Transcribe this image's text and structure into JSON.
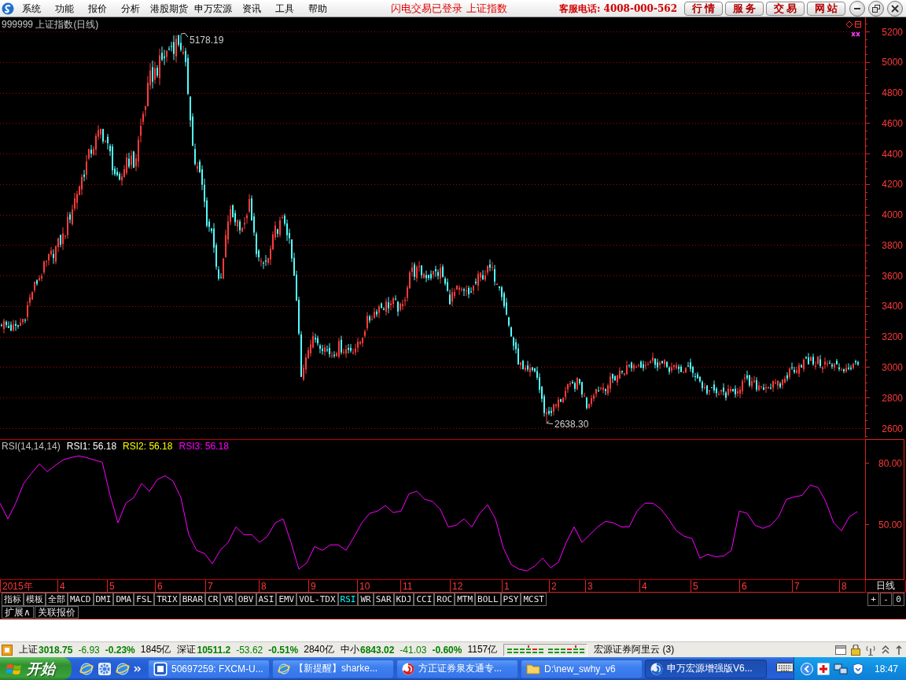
{
  "menu_bar": {
    "menus": [
      "系统",
      "功能",
      "报价",
      "分析",
      "港股期货",
      "申万宏源",
      "资讯",
      "工具",
      "帮助"
    ],
    "notices": [
      "闪电交易已登录",
      "上证指数"
    ],
    "hotline": "客服电话: 4008-000-562",
    "shortcuts": [
      "行 情",
      "服 务",
      "交 易",
      "网 站"
    ]
  },
  "price_chart": {
    "title": "999999 上证指数(日线)",
    "axis_labels": [
      "5200",
      "5000",
      "4800",
      "4600",
      "4400",
      "4200",
      "4000",
      "3800",
      "3600",
      "3400",
      "3200",
      "3000",
      "2800",
      "2600"
    ],
    "high_label": "5178.19",
    "low_label": "2638.30"
  },
  "indicator_panel": {
    "title": "RSI(14,14,14)",
    "legend": [
      {
        "text": "RSI1: 56.18",
        "color": "#ffffff"
      },
      {
        "text": "RSI2: 56.18",
        "color": "#ffff00"
      },
      {
        "text": "RSI3: 56.18",
        "color": "#ff00ff"
      }
    ],
    "chart_data": {
      "type": "line",
      "ylim": [
        23,
        91.5
      ],
      "yticks": [
        {
          "value": 80,
          "label": "80.00"
        },
        {
          "value": 50,
          "label": "50.00"
        }
      ],
      "series": [
        {
          "color": "#ff00ff",
          "values": [
            60.4,
            52.7,
            60.4,
            70.0,
            75.0,
            79.6,
            75.8,
            78.8,
            81.5,
            82.7,
            83.5,
            82.7,
            81.5,
            80.4,
            64.2,
            50.8,
            60.4,
            63.1,
            70.0,
            66.2,
            71.9,
            73.8,
            71.2,
            63.1,
            45.0,
            37.3,
            35.8,
            30.8,
            37.3,
            41.2,
            48.8,
            45.0,
            45.0,
            41.2,
            44.2,
            50.8,
            52.7,
            41.2,
            28.1,
            31.2,
            39.2,
            37.3,
            40.0,
            40.0,
            37.3,
            43.8,
            50.8,
            55.4,
            56.5,
            59.2,
            55.8,
            56.5,
            65.0,
            66.2,
            62.3,
            61.2,
            57.3,
            48.8,
            49.6,
            52.7,
            48.8,
            55.4,
            59.6,
            52.7,
            38.5,
            30.4,
            28.1,
            27.3,
            29.6,
            33.5,
            28.8,
            31.5,
            41.2,
            48.8,
            41.2,
            45.0,
            48.8,
            51.5,
            50.8,
            48.8,
            48.8,
            56.5,
            60.4,
            60.4,
            57.7,
            52.7,
            46.9,
            44.2,
            43.1,
            33.5,
            35.4,
            34.2,
            34.6,
            37.3,
            56.5,
            55.4,
            49.6,
            48.1,
            49.6,
            53.8,
            62.3,
            63.5,
            64.2,
            69.2,
            68.1,
            61.2,
            50.8,
            46.9,
            53.8,
            56.2
          ]
        }
      ]
    }
  },
  "time_axis": {
    "labels": [
      "2015年",
      "4",
      "5",
      "6",
      "7",
      "8",
      "9",
      "10",
      "11",
      "12",
      "1",
      "2",
      "3",
      "4",
      "5",
      "6",
      "7",
      "8"
    ],
    "period": "日线"
  },
  "indicator_tabs": {
    "items": [
      {
        "label": "指标",
        "selected": false
      },
      {
        "label": "模板",
        "selected": false
      },
      {
        "label": "全部",
        "selected": false
      },
      {
        "label": "MACD",
        "selected": false
      },
      {
        "label": "DMI",
        "selected": false
      },
      {
        "label": "DMA",
        "selected": false
      },
      {
        "label": "FSL",
        "selected": false
      },
      {
        "label": "TRIX",
        "selected": false
      },
      {
        "label": "BRAR",
        "selected": false
      },
      {
        "label": "CR",
        "selected": false
      },
      {
        "label": "VR",
        "selected": false
      },
      {
        "label": "OBV",
        "selected": false
      },
      {
        "label": "ASI",
        "selected": false
      },
      {
        "label": "EMV",
        "selected": false
      },
      {
        "label": "VOL-TDX",
        "selected": false
      },
      {
        "label": "RSI",
        "selected": true
      },
      {
        "label": "WR",
        "selected": false
      },
      {
        "label": "SAR",
        "selected": false
      },
      {
        "label": "KDJ",
        "selected": false
      },
      {
        "label": "CCI",
        "selected": false
      },
      {
        "label": "ROC",
        "selected": false
      },
      {
        "label": "MTM",
        "selected": false
      },
      {
        "label": "BOLL",
        "selected": false
      },
      {
        "label": "PSY",
        "selected": false
      },
      {
        "label": "MCST",
        "selected": false
      }
    ],
    "zoom_buttons": [
      "+",
      "-",
      "0"
    ]
  },
  "panel_tabs": [
    "扩展∧",
    "关联报价"
  ],
  "status_bar": {
    "indices": [
      {
        "name": "上证",
        "value": "3018.75",
        "change": "-6.93",
        "percent": "-0.23%",
        "turnover": "1845亿",
        "falling": true
      },
      {
        "name": "深证",
        "value": "10511.2",
        "change": "-53.62",
        "percent": "-0.51%",
        "turnover": "2840亿",
        "falling": true
      },
      {
        "name": "中小",
        "value": "6843.02",
        "change": "-41.03",
        "percent": "-0.60%",
        "turnover": "1157亿",
        "falling": true
      }
    ],
    "broker": "宏源证券阿里云 (3)"
  },
  "taskbar": {
    "start_label": "开始",
    "tasks": [
      {
        "label": "50697259: FXCM-U...",
        "selected": false
      },
      {
        "label": "【新提醒】sharke...",
        "selected": false
      },
      {
        "label": "方正证券泉友通专...",
        "selected": false
      },
      {
        "label": "D:\\new_swhy_v6",
        "selected": false
      },
      {
        "label": "申万宏源增强版V6...",
        "selected": true
      }
    ],
    "clock": "18:47"
  }
}
